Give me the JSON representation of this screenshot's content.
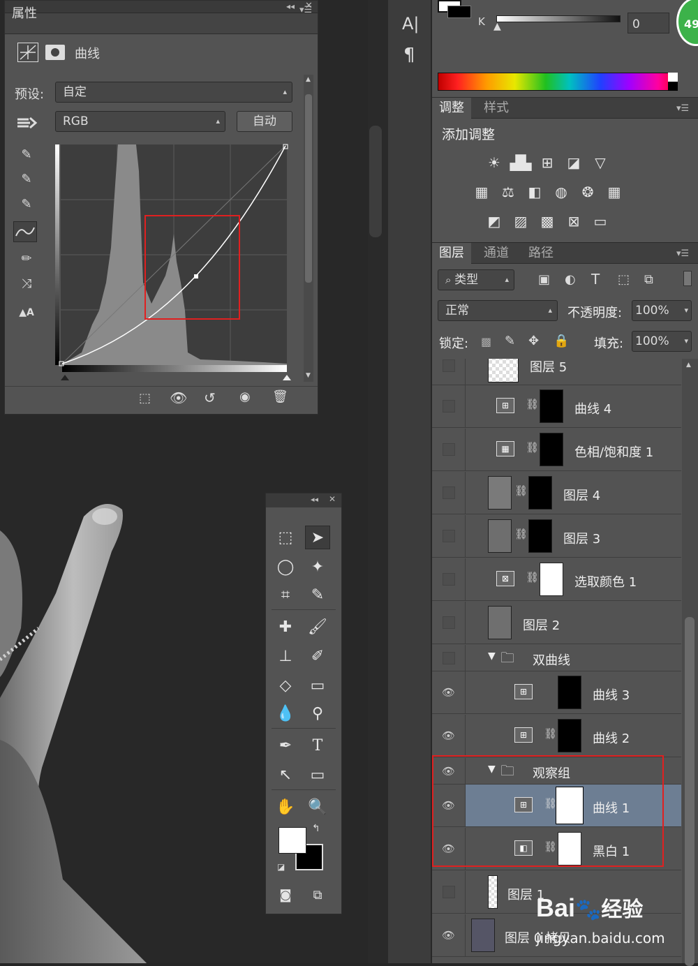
{
  "properties": {
    "title": "属性",
    "panel_name": "曲线",
    "preset_label": "预设:",
    "preset_value": "自定",
    "channel_value": "RGB",
    "auto_button": "自动"
  },
  "strip": {
    "char_tool": "A|",
    "paragraph": "¶"
  },
  "color": {
    "channel_label": "K",
    "value": "0",
    "badge": "49"
  },
  "adjustments": {
    "tabs": [
      "调整",
      "样式"
    ],
    "header": "添加调整"
  },
  "layers": {
    "tabs": [
      "图层",
      "通道",
      "路径"
    ],
    "filter": "类型",
    "blend_mode": "正常",
    "opacity_label": "不透明度:",
    "opacity_value": "100%",
    "lock_label": "锁定:",
    "fill_label": "填充:",
    "fill_value": "100%",
    "rows": [
      {
        "name": "图层 5",
        "visible": false
      },
      {
        "name": "曲线 4",
        "visible": false
      },
      {
        "name": "色相/饱和度 1",
        "visible": false
      },
      {
        "name": "图层 4",
        "visible": false
      },
      {
        "name": "图层 3",
        "visible": false
      },
      {
        "name": "选取颜色 1",
        "visible": false
      },
      {
        "name": "图层 2",
        "visible": false
      },
      {
        "name": "双曲线",
        "visible": false
      },
      {
        "name": "曲线 3",
        "visible": true
      },
      {
        "name": "曲线 2",
        "visible": true
      },
      {
        "name": "观察组",
        "visible": true
      },
      {
        "name": "曲线 1",
        "visible": true,
        "selected": true
      },
      {
        "name": "黑白 1",
        "visible": true
      },
      {
        "name": "图层 1",
        "visible": false
      },
      {
        "name": "图层 0 拷贝",
        "visible": true
      }
    ]
  },
  "watermark": {
    "brand": "Bai",
    "brand2": "经验",
    "url": "jingyan.baidu.com"
  },
  "colors": {
    "panel": "#535353",
    "dark": "#262626",
    "selected": "#6d7e93",
    "highlight": "#e02020"
  }
}
